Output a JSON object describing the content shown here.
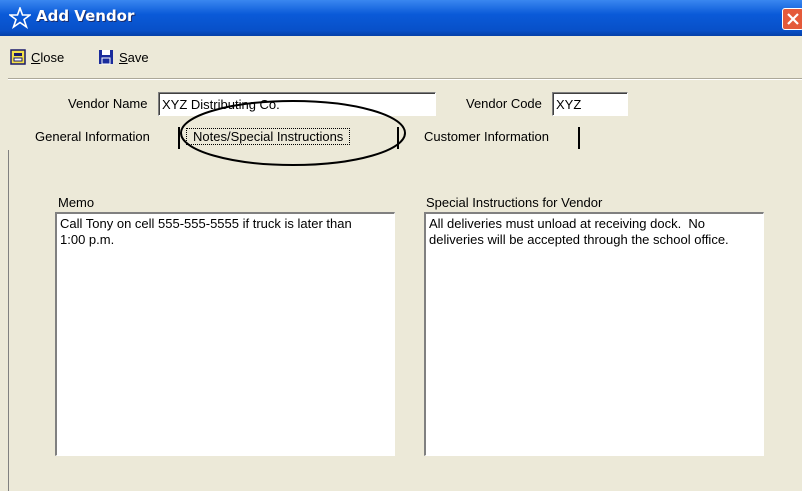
{
  "window": {
    "title": "Add Vendor",
    "title_icon": "star-icon",
    "close_icon": "close-icon"
  },
  "toolbar": {
    "close_label_accel": "C",
    "close_label_rest": "lose",
    "close_icon": "close-door-icon",
    "save_label_accel": "S",
    "save_label_rest": "ave",
    "save_icon": "floppy-disk-icon"
  },
  "vendor": {
    "name_label": "Vendor Name",
    "name_value": "XYZ Distributing Co.",
    "code_label": "Vendor Code",
    "code_value": "XYZ"
  },
  "tabs": [
    {
      "label": "General Information"
    },
    {
      "label": "Notes/Special Instructions",
      "selected": true
    },
    {
      "label": "Customer Information"
    }
  ],
  "notes": {
    "memo_label": "Memo",
    "memo_value": "Call Tony on cell 555-555-5555 if truck is later than\n1:00 p.m.",
    "special_label": "Special Instructions for Vendor",
    "special_value": "All deliveries must unload at receiving dock.  No\ndeliveries will be accepted through the school office."
  },
  "colors": {
    "titlebar": "#0a5ad8",
    "window_bg": "#ece9d8",
    "close_button": "#e45a3a"
  }
}
